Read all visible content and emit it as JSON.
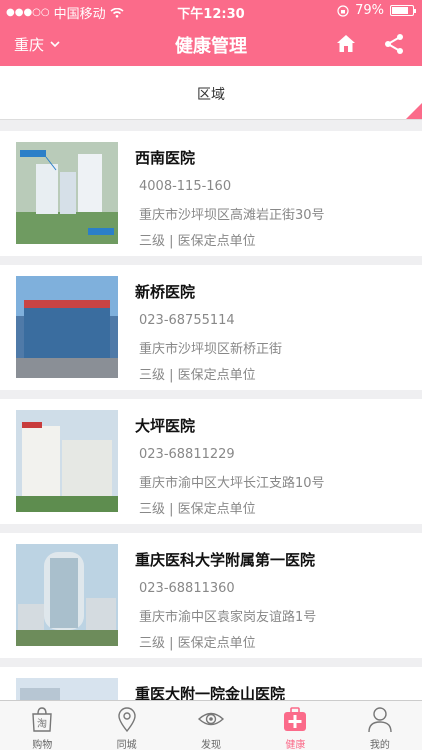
{
  "status_bar": {
    "carrier": "中国移动",
    "time": "下午12:30",
    "battery": "79%",
    "battery_level": 0.79
  },
  "header": {
    "city": "重庆",
    "title": "健康管理",
    "icons": [
      "home-icon",
      "share-icon"
    ]
  },
  "filter": {
    "region_label": "区域"
  },
  "hospitals": [
    {
      "name": "西南医院",
      "phone": "4008-115-160",
      "address": "重庆市沙坪坝区高滩岩正街30号",
      "grade": "三级 | 医保定点单位"
    },
    {
      "name": "新桥医院",
      "phone": "023-68755114",
      "address": "重庆市沙坪坝区新桥正街",
      "grade": "三级 | 医保定点单位"
    },
    {
      "name": "大坪医院",
      "phone": "023-68811229",
      "address": "重庆市渝中区大坪长江支路10号",
      "grade": "三级 | 医保定点单位"
    },
    {
      "name": "重庆医科大学附属第一医院",
      "phone": "023-68811360",
      "address": "重庆市渝中区袁家岗友谊路1号",
      "grade": "三级 | 医保定点单位"
    },
    {
      "name": "重医大附一院金山医院",
      "phone": "",
      "address": "",
      "grade": ""
    }
  ],
  "tabbar": {
    "items": [
      {
        "label": "购物",
        "icon": "shopping-bag-icon"
      },
      {
        "label": "同城",
        "icon": "location-pin-icon"
      },
      {
        "label": "发现",
        "icon": "eye-icon"
      },
      {
        "label": "健康",
        "icon": "medical-kit-icon"
      },
      {
        "label": "我的",
        "icon": "user-icon"
      }
    ],
    "active_index": 3
  },
  "colors": {
    "accent": "#fb6b8a",
    "background": "#efeff1"
  }
}
